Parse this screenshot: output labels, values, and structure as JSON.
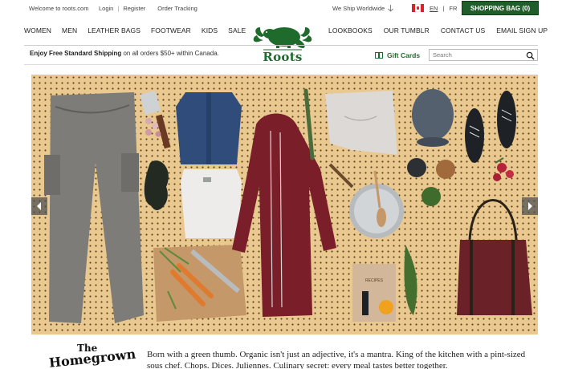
{
  "topbar": {
    "welcome": "Welcome to roots.com",
    "login": "Login",
    "register": "Register",
    "order_tracking": "Order Tracking",
    "ship_worldwide": "We Ship Worldwide",
    "lang_en": "EN",
    "lang_fr": "FR",
    "bag_label": "SHOPPING BAG (0)"
  },
  "nav": {
    "left": [
      "WOMEN",
      "MEN",
      "LEATHER BAGS",
      "FOOTWEAR",
      "KIDS",
      "SALE"
    ],
    "right": [
      "LOOKBOOKS",
      "OUR TUMBLR",
      "CONTACT US",
      "EMAIL SIGN UP"
    ]
  },
  "logo": {
    "text": "Roots"
  },
  "promo": {
    "bold": "Enjoy Free Standard Shipping",
    "rest": " on all orders $50+ within Canada."
  },
  "gift_cards": "Gift Cards",
  "search": {
    "placeholder": "Search"
  },
  "content": {
    "title_small": "The",
    "title_large": "Homegrown",
    "body": "Born with a green thumb. Organic isn't just an adjective, it's a mantra. King of the kitchen with a pint-sized sous chef. Chops. Dices. Juliennes. Culinary secret: every meal tastes better together."
  },
  "hero_labels": {
    "recipes": "RECIPES"
  },
  "colors": {
    "brand_green": "#1f5e2b",
    "pegboard": "#e9c98f"
  }
}
